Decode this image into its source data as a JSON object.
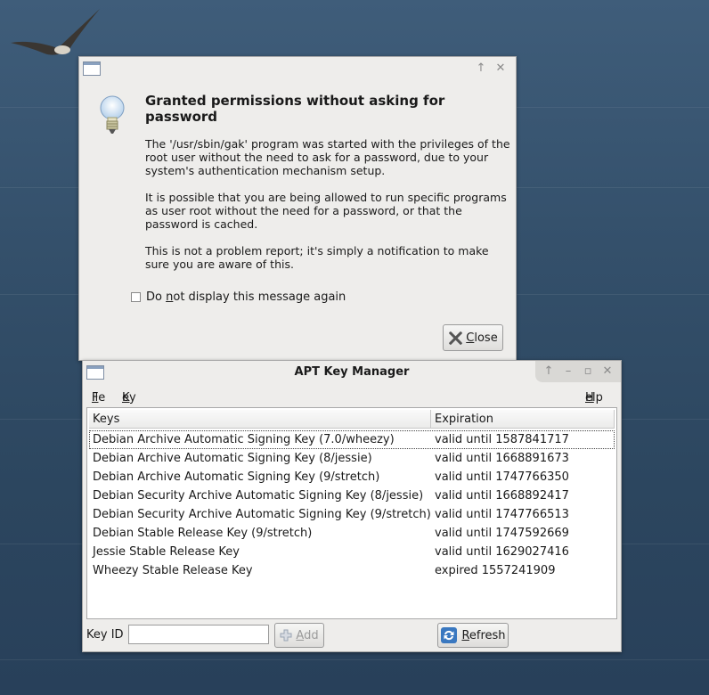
{
  "dialog": {
    "title": "Granted permissions without asking for password",
    "para1": "The '/usr/sbin/gak' program was started with the privileges of the root user without the need to ask for a password, due to your system's authentication mechanism setup.",
    "para2": "It is possible that you are being allowed to run specific programs as user root without the need for a password, or that the password is cached.",
    "para3": "This is not a problem report; it's simply a notification to make sure you are aware of this.",
    "checkbox_pre": "Do ",
    "checkbox_mnemonic": "n",
    "checkbox_post": "ot display this message again",
    "checkbox_checked": false,
    "close_mnemonic": "C",
    "close_rest": "lose"
  },
  "main": {
    "title": "APT Key Manager",
    "menu": {
      "file_mn": "F",
      "file_rest": "ile",
      "key_mn": "K",
      "key_rest": "ey",
      "help_mn": "H",
      "help_rest": "elp"
    },
    "columns": [
      "Keys",
      "Expiration"
    ],
    "rows": [
      {
        "key": "Debian Archive Automatic Signing Key (7.0/wheezy)",
        "exp": "valid until 1587841717"
      },
      {
        "key": "Debian Archive Automatic Signing Key (8/jessie)",
        "exp": "valid until 1668891673"
      },
      {
        "key": "Debian Archive Automatic Signing Key (9/stretch)",
        "exp": "valid until 1747766350"
      },
      {
        "key": "Debian Security Archive Automatic Signing Key (8/jessie)",
        "exp": "valid until 1668892417"
      },
      {
        "key": "Debian Security Archive Automatic Signing Key (9/stretch)",
        "exp": "valid until 1747766513"
      },
      {
        "key": "Debian Stable Release Key (9/stretch)",
        "exp": "valid until 1747592669"
      },
      {
        "key": "Jessie Stable Release Key",
        "exp": "valid until 1629027416"
      },
      {
        "key": "Wheezy Stable Release Key",
        "exp": "expired 1557241909"
      }
    ],
    "keyid_label": "Key ID",
    "keyid_value": "",
    "add_mn": "A",
    "add_rest": "dd",
    "refresh_mn": "R",
    "refresh_rest": "efresh"
  },
  "colors": {
    "accent": "#2f6fb0",
    "window_bg": "#eeedeb"
  },
  "icons": [
    "window-menu-icon",
    "maximize-icon",
    "close-icon",
    "lightbulb-icon",
    "plus-icon",
    "refresh-icon",
    "minimize-icon",
    "restore-icon"
  ]
}
